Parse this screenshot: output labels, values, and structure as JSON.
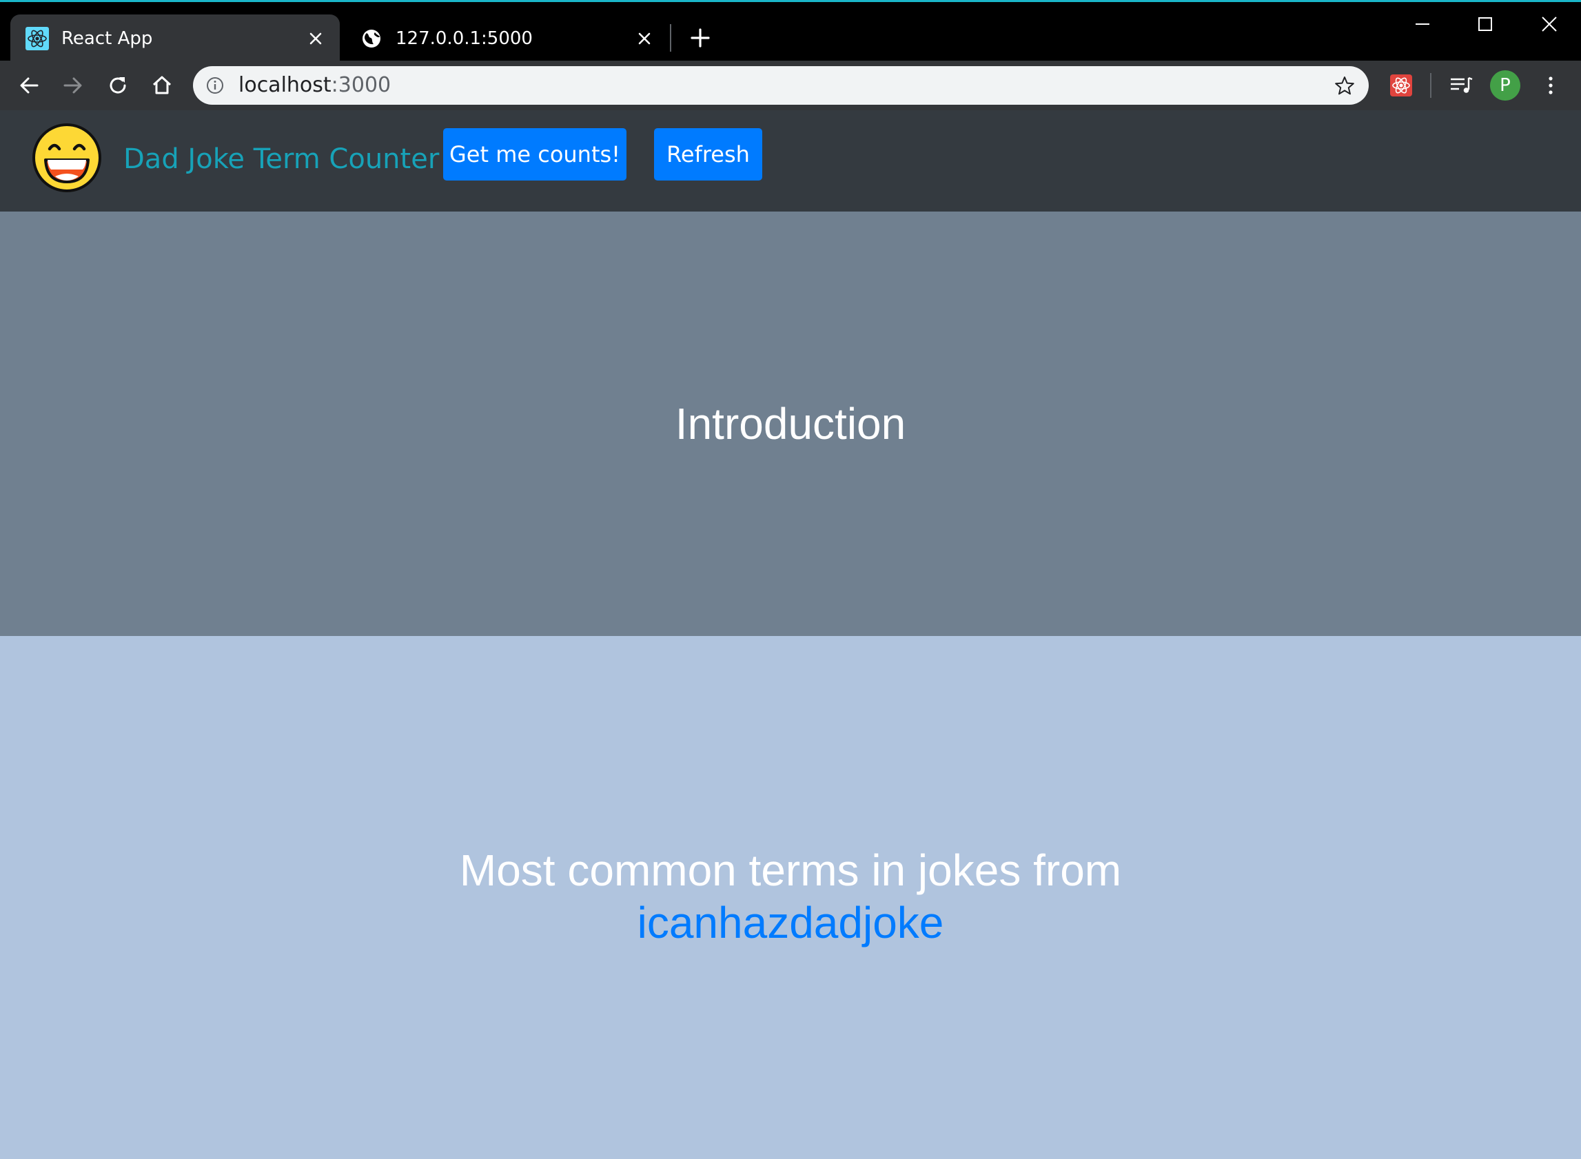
{
  "browser": {
    "tabs": [
      {
        "title": "React App",
        "active": true
      },
      {
        "title": "127.0.0.1:5000",
        "active": false
      }
    ],
    "url": {
      "host": "localhost",
      "port": ":3000"
    },
    "profile_initial": "P"
  },
  "navbar": {
    "brand": "Dad Joke Term Counter",
    "buttons": {
      "counts": "Get me counts!",
      "refresh": "Refresh"
    }
  },
  "sections": {
    "intro": {
      "heading": "Introduction"
    },
    "terms": {
      "heading_prefix": "Most common terms in jokes from",
      "link_text": "icanhazdadjoke"
    }
  },
  "colors": {
    "navbar_bg": "#343a40",
    "brand": "#17a2b8",
    "button": "#007bff",
    "intro_bg": "#708090",
    "terms_bg": "#b0c4de",
    "link": "#007bff"
  }
}
